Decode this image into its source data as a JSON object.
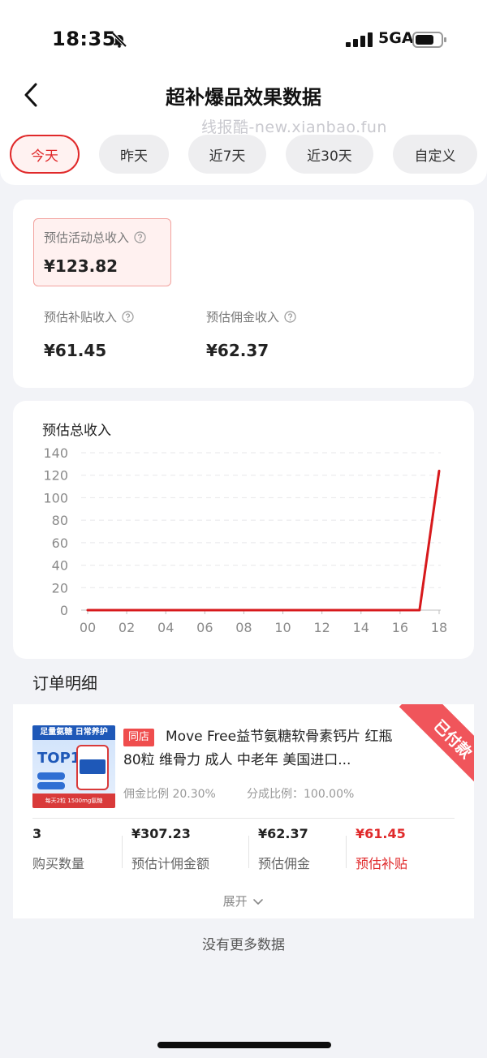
{
  "status_bar": {
    "time": "18:35",
    "network": "5GA"
  },
  "header": {
    "title": "超补爆品效果数据",
    "watermark": "线报酷-new.xianbao.fun"
  },
  "tabs": [
    {
      "label": "今天",
      "active": true
    },
    {
      "label": "昨天",
      "active": false
    },
    {
      "label": "近7天",
      "active": false
    },
    {
      "label": "近30天",
      "active": false
    },
    {
      "label": "自定义",
      "active": false
    }
  ],
  "summary": {
    "total_label": "预估活动总收入",
    "total_value": "¥123.82",
    "subsidy_label": "预估补贴收入",
    "subsidy_value": "¥61.45",
    "commission_label": "预估佣金收入",
    "commission_value": "¥62.37"
  },
  "chart_data": {
    "type": "line",
    "title": "预估总收入",
    "x": [
      "00",
      "01",
      "02",
      "03",
      "04",
      "05",
      "06",
      "07",
      "08",
      "09",
      "10",
      "11",
      "12",
      "13",
      "14",
      "15",
      "16",
      "17",
      "18"
    ],
    "series": [
      {
        "values": [
          0,
          0,
          0,
          0,
          0,
          0,
          0,
          0,
          0,
          0,
          0,
          0,
          0,
          0,
          0,
          0,
          0,
          0,
          123.82
        ],
        "color": "#d7191c"
      }
    ],
    "xticks": [
      "00",
      "02",
      "04",
      "06",
      "08",
      "10",
      "12",
      "14",
      "16",
      "18"
    ],
    "yticks": [
      0,
      20,
      40,
      60,
      80,
      100,
      120,
      140
    ],
    "ylim": [
      0,
      140
    ],
    "grid": "horizontal-dashed"
  },
  "orders": {
    "section_title": "订单明细",
    "status_ribbon": "已付款",
    "shop_tag": "同店",
    "product_title": "Move Free益节氨糖软骨素钙片 红瓶80粒 维骨力 成人 中老年 美国进口...",
    "image_text": {
      "header": "足量氨糖 日常养护",
      "badge": "TOP1",
      "footer": "每天2粒 1500mg氨糖"
    },
    "commission_rate": "佣金比例 20.30%",
    "split_rate": "分成比例：100.00%",
    "stats": [
      {
        "value": "3",
        "label": "购买数量"
      },
      {
        "value": "¥307.23",
        "label": "预估计佣金额"
      },
      {
        "value": "¥62.37",
        "label": "预估佣金"
      },
      {
        "value": "¥61.45",
        "label": "预估补贴"
      }
    ],
    "expand_label": "展开",
    "no_more": "没有更多数据"
  },
  "colors": {
    "accent": "#e0292a",
    "line": "#d7191c",
    "ribbon": "#f0555b"
  }
}
